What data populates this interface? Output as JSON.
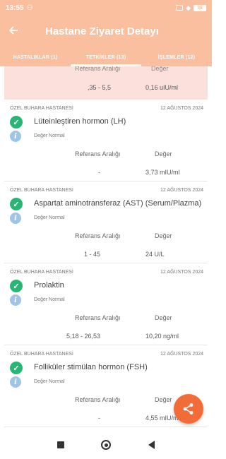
{
  "status_bar": {
    "time": "13:55",
    "battery": "36"
  },
  "header": {
    "title": "Hastane Ziyaret Detayı"
  },
  "tabs": [
    {
      "label": "HASTALIKLAR (1)"
    },
    {
      "label": "TETKİKLER (13)"
    },
    {
      "label": "İŞLEMLER (12)"
    }
  ],
  "partial_card": {
    "ref_label": "Referans Aralığı",
    "val_label": "Değer",
    "ref": ",35 - 5,5",
    "val": "0,16 uIU/ml"
  },
  "cards": [
    {
      "hospital": "ÖZEL BUHARA HASTANESİ",
      "date": "12 AĞUSTOS 2024",
      "name": "Lüteinleştiren hormon (LH)",
      "status": "Değer Normal",
      "ref_label": "Referans Aralığı",
      "val_label": "Değer",
      "ref": "-",
      "val": "3,73 mIU/ml"
    },
    {
      "hospital": "ÖZEL BUHARA HASTANESİ",
      "date": "12 AĞUSTOS 2024",
      "name": "Aspartat aminotransferaz (AST) (Serum/Plazma)",
      "status": "Değer Normal",
      "ref_label": "Referans Aralığı",
      "val_label": "Değer",
      "ref": "1 - 45",
      "val": "24 U/L"
    },
    {
      "hospital": "ÖZEL BUHARA HASTANESİ",
      "date": "12 AĞUSTOS 2024",
      "name": "Prolaktin",
      "status": "Değer Normal",
      "ref_label": "Referans Aralığı",
      "val_label": "Değer",
      "ref": "5,18 - 26,53",
      "val": "10,20 ng/ml"
    },
    {
      "hospital": "ÖZEL BUHARA HASTANESİ",
      "date": "12 AĞUSTOS 2024",
      "name": "Folliküler stimülan hormon (FSH)",
      "status": "Değer Normal",
      "ref_label": "Referans Aralığı",
      "val_label": "Değer",
      "ref": "-",
      "val": "4,55 mIU/ml"
    }
  ],
  "colors": {
    "header": "#f9bf9f",
    "accent": "#f26c3a",
    "check": "#29b574",
    "info": "#9ec5e8",
    "abnormal_bg": "#fce0dc"
  }
}
